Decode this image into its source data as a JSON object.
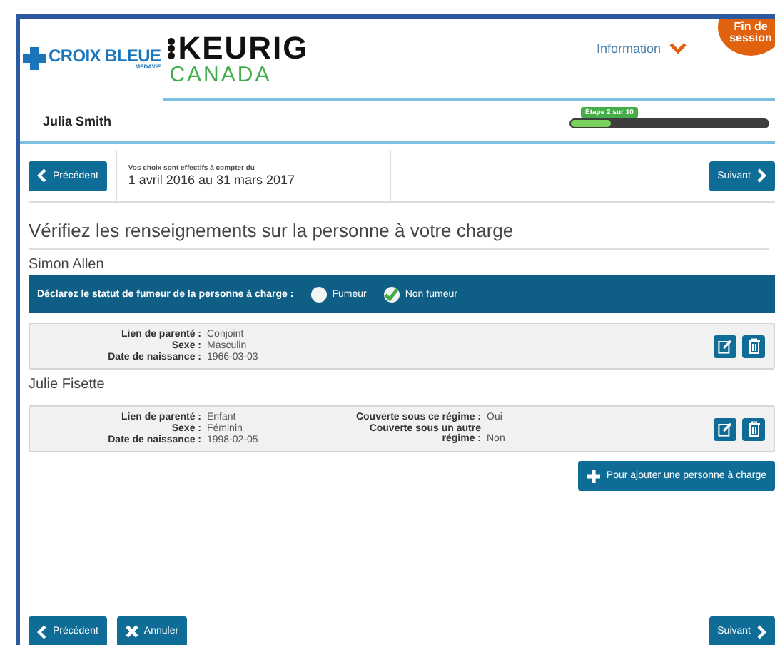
{
  "header": {
    "brand_left": {
      "name": "CROIX BLEUE",
      "sub": "MEDAVIE"
    },
    "brand_right": {
      "name": "KEURIG",
      "sub": "CANADA"
    },
    "info_menu": "Information",
    "session_button": "Fin de session"
  },
  "user": {
    "name": "Julia Smith"
  },
  "progress": {
    "label": "Étape 2 sur 10",
    "level": 0.2
  },
  "nav": {
    "previous": "Précédent",
    "effective_label": "Vos choix sont effectifs à compter du",
    "effective_dates": "1 avril 2016 au 31 mars 2017",
    "next": "Suivant"
  },
  "title": "Vérifiez les renseignements sur la personne à votre charge",
  "dependents": [
    {
      "name": "Simon Allen",
      "smoker": {
        "question": "Déclarez le statut de fumeur de la personne à charge :",
        "options": [
          {
            "label": "Fumeur",
            "selected": false
          },
          {
            "label": "Non fumeur",
            "selected": true
          }
        ]
      },
      "details_left": [
        {
          "label": "Lien de parenté :",
          "value": "Conjoint"
        },
        {
          "label": "Sexe :",
          "value": "Masculin"
        },
        {
          "label": "Date de naissance :",
          "value": "1966-03-03"
        }
      ]
    },
    {
      "name": "Julie Fisette",
      "details_left": [
        {
          "label": "Lien de parenté :",
          "value": "Enfant"
        },
        {
          "label": "Sexe :",
          "value": "Féminin"
        },
        {
          "label": "Date de naissance :",
          "value": "1998-02-05"
        }
      ],
      "details_right": [
        {
          "label": "Couverte sous ce régime :",
          "value": "Oui"
        },
        {
          "label": "Couverte sous un autre régime :",
          "value": "Non"
        }
      ]
    }
  ],
  "add_button": "Pour ajouter une personne à charge",
  "footer": {
    "previous": "Précédent",
    "cancel": "Annuler",
    "next": "Suivant"
  }
}
